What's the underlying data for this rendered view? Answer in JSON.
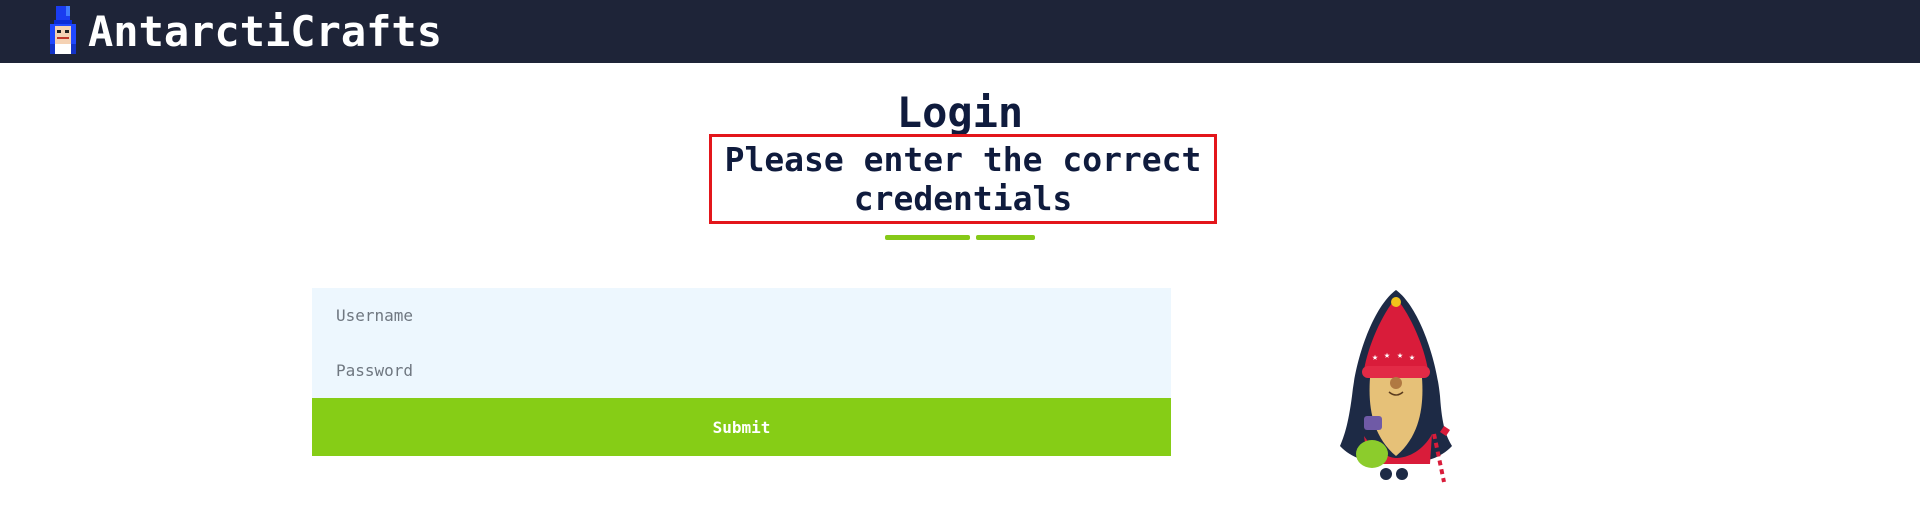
{
  "navbar": {
    "brand": "AntarctiCrafts",
    "logo_icon": "toy-soldier-icon"
  },
  "main": {
    "title": "Login",
    "alert": "Please enter the correct credentials"
  },
  "form": {
    "username_placeholder": "Username",
    "password_placeholder": "Password",
    "submit_label": "Submit"
  },
  "illustration": {
    "icon": "elf-illustration"
  },
  "colors": {
    "navbar_bg": "#1e2438",
    "accent_green": "#86cd16",
    "alert_border": "#e3161b",
    "input_bg": "#edf7fe",
    "heading": "#0f1b3d"
  }
}
